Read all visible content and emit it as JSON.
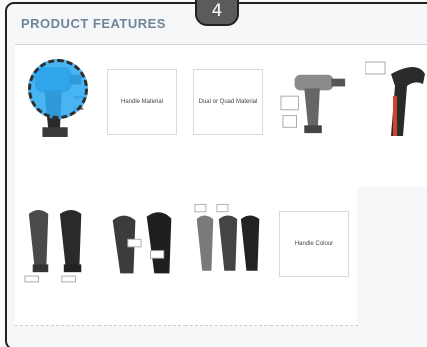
{
  "section": {
    "title": "PRODUCT FEATURES"
  },
  "step": {
    "number": "4"
  },
  "features": [
    {
      "label": "",
      "image": "product-photo-cyan-drill"
    },
    {
      "label": "",
      "image": "text-card",
      "card_text": "Handle Material"
    },
    {
      "label": "",
      "image": "text-card",
      "card_text": "Dual or Quad Material"
    },
    {
      "label": "",
      "image": "product-photo-drill-with-callouts"
    },
    {
      "label": "",
      "image": "product-photo-dark-drill-partial"
    },
    {
      "label": "",
      "image": "product-photo-two-drills"
    },
    {
      "label": "",
      "image": "product-photo-two-drills-labeled"
    },
    {
      "label": "",
      "image": "product-photo-three-drills"
    },
    {
      "label": "",
      "image": "text-card",
      "card_text": "Handle Colour"
    }
  ],
  "colors": {
    "accent": "#30aaf0",
    "link": "#7fa3c9",
    "title": "#6f8597",
    "badge": "#5b5b5b"
  }
}
